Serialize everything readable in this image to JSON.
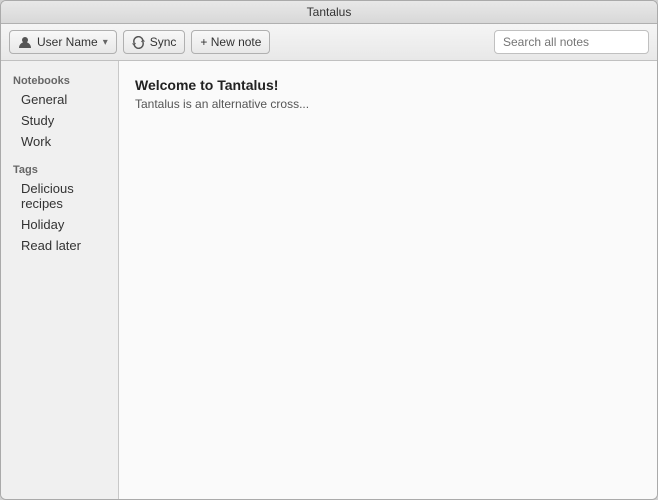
{
  "titleBar": {
    "title": "Tantalus"
  },
  "toolbar": {
    "userButtonLabel": "User Name",
    "syncButtonLabel": "Sync",
    "newNoteButtonLabel": "+ New note",
    "searchPlaceholder": "Search all notes"
  },
  "sidebar": {
    "notebooksLabel": "Notebooks",
    "notebooks": [
      {
        "label": "General"
      },
      {
        "label": "Study"
      },
      {
        "label": "Work"
      }
    ],
    "tagsLabel": "Tags",
    "tags": [
      {
        "label": "Delicious recipes"
      },
      {
        "label": "Holiday"
      },
      {
        "label": "Read later"
      }
    ]
  },
  "content": {
    "welcomeTitle": "Welcome to Tantalus!",
    "welcomeText": "Tantalus is an alternative cross..."
  }
}
